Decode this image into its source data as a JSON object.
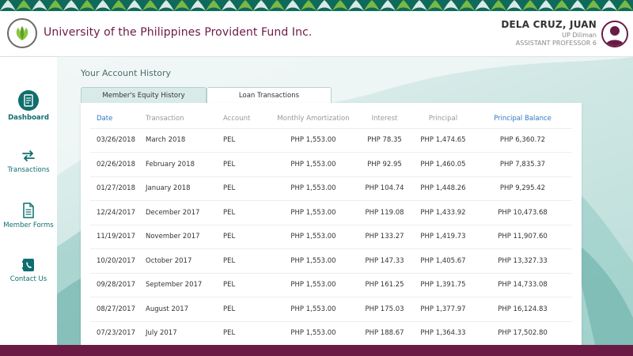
{
  "header": {
    "org_title": "University of the Philippines Provident Fund Inc.",
    "user": {
      "name": "DELA CRUZ, JUAN",
      "unit": "UP Diliman",
      "position": "ASSISTANT PROFESSOR 6"
    }
  },
  "sidebar": {
    "items": [
      {
        "label": "Dashboard",
        "icon": "dashboard-icon",
        "active": true
      },
      {
        "label": "Transactions",
        "icon": "transactions-arrows-icon",
        "active": false
      },
      {
        "label": "Member Forms",
        "icon": "document-icon",
        "active": false
      },
      {
        "label": "Contact Us",
        "icon": "phone-book-icon",
        "active": false
      }
    ]
  },
  "main": {
    "section_title": "Your Account History",
    "tabs": [
      {
        "label": "Member's Equity History",
        "active": false
      },
      {
        "label": "Loan Transactions",
        "active": true
      }
    ],
    "table": {
      "columns": [
        "Date",
        "Transaction",
        "Account",
        "Monthly Amortization",
        "Interest",
        "Principal",
        "Principal Balance"
      ],
      "rows": [
        [
          "03/26/2018",
          "March 2018",
          "PEL",
          "PHP 1,553.00",
          "PHP 78.35",
          "PHP 1,474.65",
          "PHP 6,360.72"
        ],
        [
          "02/26/2018",
          "February 2018",
          "PEL",
          "PHP 1,553.00",
          "PHP 92.95",
          "PHP 1,460.05",
          "PHP 7,835.37"
        ],
        [
          "01/27/2018",
          "January 2018",
          "PEL",
          "PHP 1,553.00",
          "PHP 104.74",
          "PHP 1,448.26",
          "PHP 9,295.42"
        ],
        [
          "12/24/2017",
          "December 2017",
          "PEL",
          "PHP 1,553.00",
          "PHP 119.08",
          "PHP 1,433.92",
          "PHP 10,473.68"
        ],
        [
          "11/19/2017",
          "November 2017",
          "PEL",
          "PHP 1,553.00",
          "PHP 133.27",
          "PHP 1,419.73",
          "PHP 11,907.60"
        ],
        [
          "10/20/2017",
          "October 2017",
          "PEL",
          "PHP 1,553.00",
          "PHP 147.33",
          "PHP 1,405.67",
          "PHP 13,327.33"
        ],
        [
          "09/28/2017",
          "September 2017",
          "PEL",
          "PHP 1,553.00",
          "PHP 161.25",
          "PHP 1,391.75",
          "PHP 14,733.08"
        ],
        [
          "08/27/2017",
          "August 2017",
          "PEL",
          "PHP 1,553.00",
          "PHP 175.03",
          "PHP 1,377.97",
          "PHP 16,124.83"
        ],
        [
          "07/23/2017",
          "July 2017",
          "PEL",
          "PHP 1,553.00",
          "PHP 188.67",
          "PHP 1,364.33",
          "PHP 17,502.80"
        ]
      ]
    }
  },
  "colors": {
    "brand_maroon": "#6b1a45",
    "teal": "#0f6e6e",
    "link_blue": "#2e79c2",
    "pattern_green": "#0e6a5a"
  }
}
